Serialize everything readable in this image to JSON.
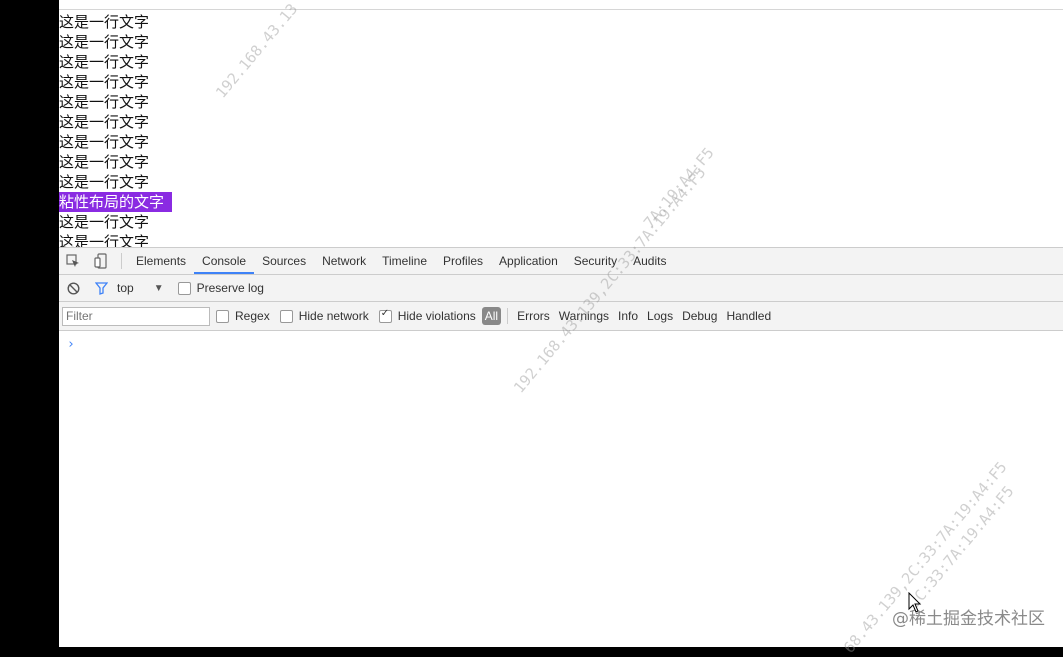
{
  "page": {
    "lines_before": [
      "这是一行文字",
      "这是一行文字",
      "这是一行文字",
      "这是一行文字",
      "这是一行文字",
      "这是一行文字",
      "这是一行文字",
      "这是一行文字",
      "这是一行文字"
    ],
    "sticky_text": "粘性布局的文字",
    "lines_after": [
      "这是一行文字",
      "这是一行文字"
    ]
  },
  "devtools": {
    "tabs": [
      "Elements",
      "Console",
      "Sources",
      "Network",
      "Timeline",
      "Profiles",
      "Application",
      "Security",
      "Audits"
    ],
    "active_tab": "Console",
    "context": "top",
    "preserve_log_label": "Preserve log",
    "filter_placeholder": "Filter",
    "regex_label": "Regex",
    "hide_network_label": "Hide network",
    "hide_violations_label": "Hide violations",
    "level_all": "All",
    "levels": [
      "Errors",
      "Warnings",
      "Info",
      "Logs",
      "Debug",
      "Handled"
    ],
    "prompt_symbol": "›"
  },
  "watermark": {
    "texts": [
      "192.168.43.13",
      "7A:19:A4:F5",
      "192.168.43.139,2C:33:7A:19:A4:F5",
      "2C:33:7A:19:A4:F5",
      "68.43.139,2C:33:7A:19:A4:F5"
    ],
    "site": "@稀土掘金技术社区"
  },
  "colors": {
    "sticky_bg": "#8a2be2",
    "accent": "#3e82f7"
  }
}
